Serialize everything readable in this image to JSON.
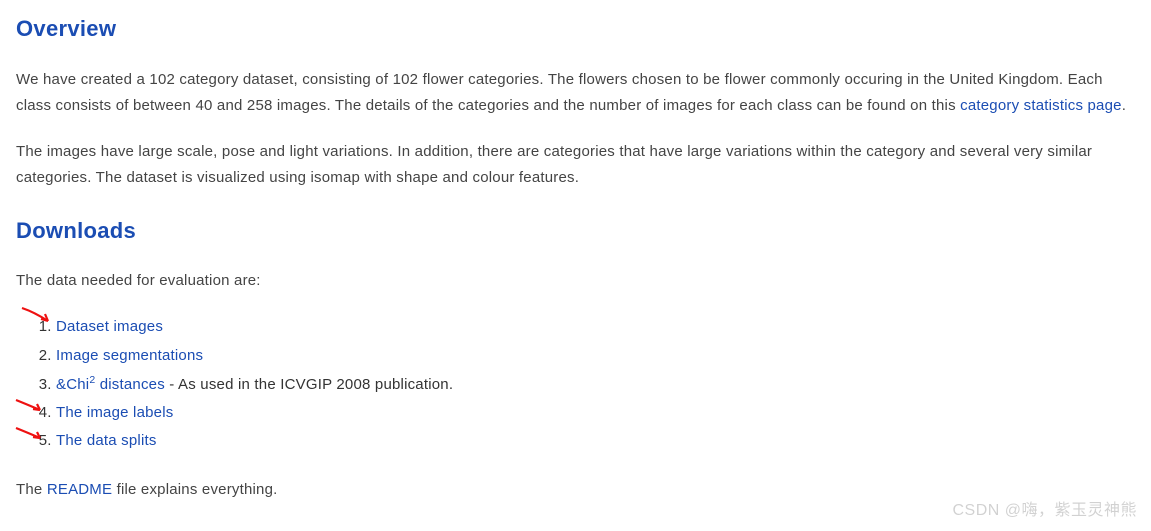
{
  "overview": {
    "heading": "Overview",
    "p1_a": "We have created a 102 category dataset, consisting of 102 flower categories. The flowers chosen to be flower commonly occuring in the United Kingdom. Each class consists of between 40 and 258 images. The details of the categories and the number of images for each class can be found on this ",
    "p1_link": "category statistics page",
    "p1_b": ".",
    "p2": "The images have large scale, pose and light variations. In addition, there are categories that have large variations within the category and several very similar categories. The dataset is visualized using isomap with shape and colour features."
  },
  "downloads": {
    "heading": "Downloads",
    "intro": "The data needed for evaluation are:",
    "items": {
      "i1": "Dataset images",
      "i2": "Image segmentations",
      "i3_link": "&Chi",
      "i3_sup": "2",
      "i3_link_tail": " distances",
      "i3_after": " - As used in the ICVGIP 2008 publication.",
      "i4": "The image labels",
      "i5": "The data splits"
    },
    "readme_a": "The ",
    "readme_link": "README",
    "readme_b": " file explains everything."
  },
  "watermark": "CSDN @嗨，紫玉灵神熊"
}
